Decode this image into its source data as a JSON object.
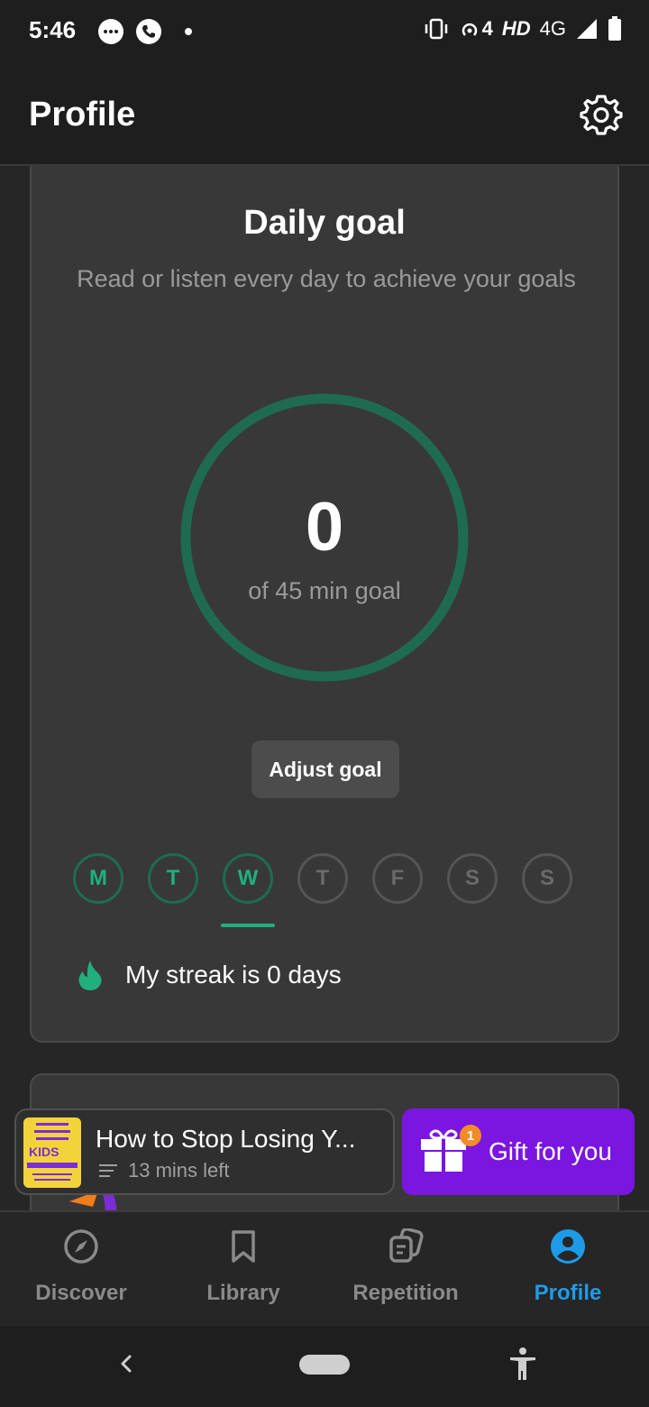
{
  "status_bar": {
    "time": "5:46",
    "network_label": "HD",
    "network_type": "4G",
    "hotspot_count": "4",
    "icons": [
      "chat-bubble-icon",
      "phone-icon",
      "dot-icon",
      "vibrate-icon",
      "hotspot-icon",
      "signal-icon",
      "battery-icon"
    ]
  },
  "header": {
    "title": "Profile",
    "settings_icon": "gear-icon"
  },
  "daily_goal": {
    "title": "Daily goal",
    "subtitle": "Read or listen every day to achieve your goals",
    "progress_value": "0",
    "progress_label": "of 45 min goal",
    "adjust_button": "Adjust goal",
    "days": [
      {
        "letter": "M",
        "state": "active"
      },
      {
        "letter": "T",
        "state": "active"
      },
      {
        "letter": "W",
        "state": "active"
      },
      {
        "letter": "T",
        "state": "inactive"
      },
      {
        "letter": "F",
        "state": "inactive"
      },
      {
        "letter": "S",
        "state": "inactive"
      },
      {
        "letter": "S",
        "state": "inactive"
      }
    ],
    "current_day_index": 2,
    "streak_text": "My streak is 0 days",
    "ring_color": "#1f6b52",
    "accent_color": "#1fb07e"
  },
  "mini_player": {
    "title": "How to Stop Losing Y...",
    "time_left": "13 mins left",
    "cover_text": "KIDS"
  },
  "gift": {
    "label": "Gift for you",
    "badge": "1",
    "color": "#7a16e0"
  },
  "bottom_nav": {
    "items": [
      {
        "label": "Discover",
        "icon": "compass-icon"
      },
      {
        "label": "Library",
        "icon": "bookmark-icon"
      },
      {
        "label": "Repetition",
        "icon": "cards-icon"
      },
      {
        "label": "Profile",
        "icon": "user-circle-icon",
        "active": true
      }
    ],
    "active_color": "#1e9be8"
  },
  "system_nav": {
    "icons": [
      "back-icon",
      "home-pill-icon",
      "accessibility-icon"
    ]
  }
}
